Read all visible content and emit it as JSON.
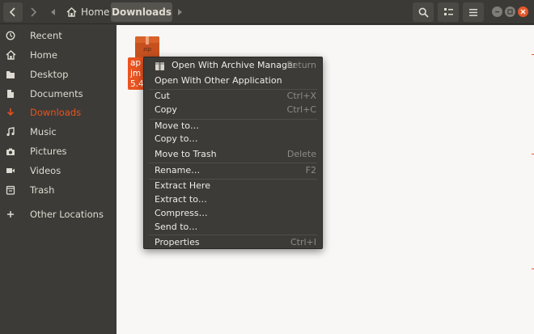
{
  "header": {
    "breadcrumbs": [
      "Home",
      "Downloads"
    ],
    "icons": {
      "back": "chevron-left-icon",
      "forward": "chevron-right-icon",
      "search": "search-icon",
      "view": "view-options-icon",
      "menu": "hamburger-menu-icon"
    }
  },
  "sidebar": {
    "items": [
      {
        "label": "Recent",
        "icon": "clock-icon"
      },
      {
        "label": "Home",
        "icon": "home-icon"
      },
      {
        "label": "Desktop",
        "icon": "folder-icon"
      },
      {
        "label": "Documents",
        "icon": "document-icon"
      },
      {
        "label": "Downloads",
        "icon": "download-icon",
        "active": true
      },
      {
        "label": "Music",
        "icon": "music-icon"
      },
      {
        "label": "Pictures",
        "icon": "camera-icon"
      },
      {
        "label": "Videos",
        "icon": "video-icon"
      },
      {
        "label": "Trash",
        "icon": "trash-icon"
      },
      {
        "label": "Other Locations",
        "icon": "plus-icon"
      }
    ]
  },
  "file": {
    "icon_label": "zip",
    "name_lines": [
      "ap",
      "jm",
      "5.4"
    ]
  },
  "context_menu": {
    "items": [
      {
        "label": "Open With Archive Manager",
        "accel": "Return",
        "icon": "archive-manager-icon"
      },
      {
        "label": "Open With Other Application",
        "accel": ""
      },
      {
        "label": "Cut",
        "accel": "Ctrl+X"
      },
      {
        "label": "Copy",
        "accel": "Ctrl+C"
      },
      {
        "label": "Move to…",
        "accel": ""
      },
      {
        "label": "Copy to…",
        "accel": ""
      },
      {
        "label": "Move to Trash",
        "accel": "Delete"
      },
      {
        "label": "Rename…",
        "accel": "F2"
      },
      {
        "label": "Extract Here",
        "accel": ""
      },
      {
        "label": "Extract to…",
        "accel": ""
      },
      {
        "label": "Compress…",
        "accel": ""
      },
      {
        "label": "Send to…",
        "accel": ""
      },
      {
        "label": "Properties",
        "accel": "Ctrl+I"
      }
    ]
  },
  "colors": {
    "accent": "#e95420",
    "sidebar_bg": "#3c3b37",
    "content_bg": "#f8f7f6",
    "menu_bg": "#3c3b37"
  }
}
